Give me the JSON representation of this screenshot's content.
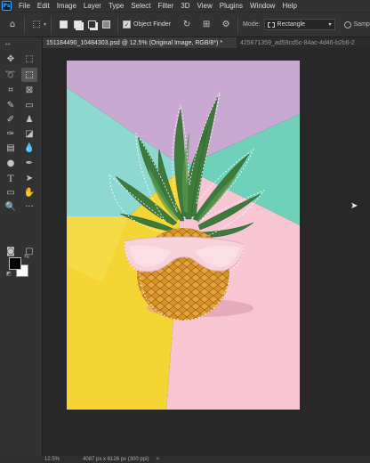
{
  "app": {
    "logo": "Ps"
  },
  "menubar": {
    "items": [
      "File",
      "Edit",
      "Image",
      "Layer",
      "Type",
      "Select",
      "Filter",
      "3D",
      "View",
      "Plugins",
      "Window",
      "Help"
    ]
  },
  "options": {
    "object_finder_label": "Object Finder",
    "object_finder_checked": "✓",
    "mode_label": "Mode:",
    "mode_value": "Rectangle",
    "sample_label": "Samp"
  },
  "tabs": {
    "active": "151184490_10484303.psd @ 12.5% (Original Image, RGB/8*) *",
    "inactive": "425671359_ad59cd5c-84ac-4d46-b2b6-2"
  },
  "status": {
    "zoom": "12.5%",
    "dimensions": "4087 px x 6126 px (300 ppi)",
    "arrow": ">"
  },
  "colors": {
    "foreground": "#000000",
    "background": "#ffffff",
    "accent": "#31a8ff"
  }
}
